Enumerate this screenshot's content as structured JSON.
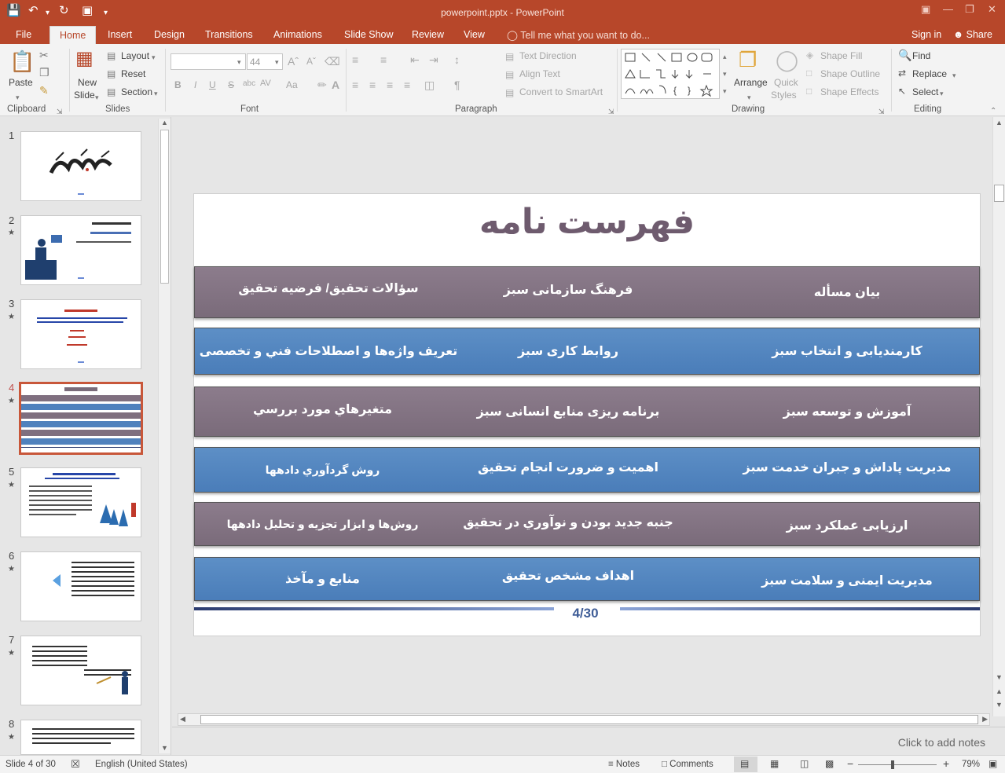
{
  "window": {
    "title": "powerpoint.pptx - PowerPoint"
  },
  "tabs": [
    "File",
    "Home",
    "Insert",
    "Design",
    "Transitions",
    "Animations",
    "Slide Show",
    "Review",
    "View"
  ],
  "active_tab": "Home",
  "tell_me": "Tell me what you want to do...",
  "account": {
    "signin": "Sign in",
    "share": "Share"
  },
  "ribbon": {
    "clipboard": {
      "paste": "Paste",
      "label": "Clipboard"
    },
    "slides": {
      "new_slide_1": "New",
      "new_slide_2": "Slide",
      "layout": "Layout",
      "reset": "Reset",
      "section": "Section",
      "label": "Slides"
    },
    "font": {
      "font_size": "44",
      "bold": "B",
      "italic": "I",
      "underline": "U",
      "strike": "S",
      "shadow": "abc",
      "spacing": "AV",
      "case": "Aa",
      "label": "Font"
    },
    "paragraph": {
      "text_direction": "Text Direction",
      "align_text": "Align Text",
      "convert_smartart": "Convert to SmartArt",
      "label": "Paragraph"
    },
    "drawing": {
      "arrange": "Arrange",
      "quick_styles_1": "Quick",
      "quick_styles_2": "Styles",
      "shape_fill": "Shape Fill",
      "shape_outline": "Shape Outline",
      "shape_effects": "Shape Effects",
      "label": "Drawing"
    },
    "editing": {
      "find": "Find",
      "replace": "Replace",
      "select": "Select",
      "label": "Editing"
    }
  },
  "thumbnails": [
    {
      "num": "1",
      "star": ""
    },
    {
      "num": "2",
      "star": "★"
    },
    {
      "num": "3",
      "star": "★"
    },
    {
      "num": "4",
      "star": "★"
    },
    {
      "num": "5",
      "star": "★"
    },
    {
      "num": "6",
      "star": "★"
    },
    {
      "num": "7",
      "star": "★"
    },
    {
      "num": "8",
      "star": "★"
    }
  ],
  "selected_slide": 4,
  "slide": {
    "title": "فهرست نامه",
    "rows": [
      {
        "c1": "بیان مسأله",
        "c2": "فرهنگ سازمانی سبز",
        "c3": "سؤالات تحقیق/ فرضیه تحقیق"
      },
      {
        "c1": "کارمندیابی و انتخاب سبز",
        "c2": "روابط کاری سبز",
        "c3": "تعریف واژه‌ها و اصطلاحات فني و تخصصی"
      },
      {
        "c1": "آموزش و توسعه سبز",
        "c2": "برنامه ریزی منابع انسانی سبز",
        "c3": "متغیرهاي مورد بررسي"
      },
      {
        "c1": "مدیریت پاداش و جبران خدمت سبز",
        "c2": "اهمیت و ضرورت انجام تحقیق",
        "c3": "روش گردآوري دادهها"
      },
      {
        "c1": "ارزیابی عملکرد سبز",
        "c2": "جنبه جدید بودن و نوآوري در تحقیق",
        "c3": "روش‌ها و ابزار تجزیه و تحلیل دادهها"
      },
      {
        "c1": "مدیریت ایمنی و سلامت سبز",
        "c2": "اهداف مشخص تحقیق",
        "c3": "منابع و مآخذ"
      }
    ],
    "page_number": "4/30"
  },
  "notes_placeholder": "Click to add notes",
  "status": {
    "slide_info": "Slide 4 of 30",
    "language": "English (United States)",
    "notes": "Notes",
    "comments": "Comments",
    "zoom": "79%"
  },
  "colors": {
    "accent": "#b7472a",
    "row_gray": "#7f6f7f",
    "row_blue": "#4f81bd",
    "title": "#6e5b6e"
  }
}
